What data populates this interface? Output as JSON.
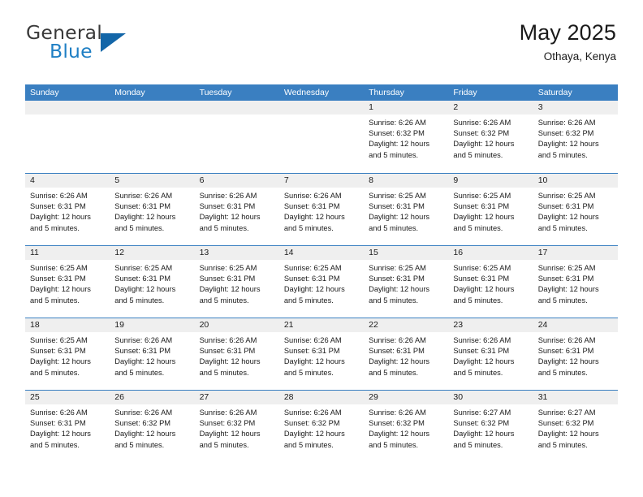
{
  "brand": {
    "name_top": "General",
    "name_bottom": "Blue",
    "triangle_icon": "brand-triangle-icon",
    "color_top": "#3a3a3a",
    "color_bottom": "#1f7fc4",
    "triangle_color": "#1366a8"
  },
  "header": {
    "title": "May 2025",
    "subtitle": "Othaya, Kenya"
  },
  "colors": {
    "header_band": "#3a7fc1",
    "day_head": "#efefef",
    "text": "#1a1a1a",
    "row_rule": "#3a7fc1"
  },
  "weekdays": [
    "Sunday",
    "Monday",
    "Tuesday",
    "Wednesday",
    "Thursday",
    "Friday",
    "Saturday"
  ],
  "labels": {
    "sunrise_prefix": "Sunrise:",
    "sunset_prefix": "Sunset:",
    "daylight_prefix": "Daylight:"
  },
  "weeks": [
    [
      {
        "day": "",
        "lines": []
      },
      {
        "day": "",
        "lines": []
      },
      {
        "day": "",
        "lines": []
      },
      {
        "day": "",
        "lines": []
      },
      {
        "day": "1",
        "lines": [
          "Sunrise: 6:26 AM",
          "Sunset: 6:32 PM",
          "Daylight: 12 hours",
          "and 5 minutes."
        ]
      },
      {
        "day": "2",
        "lines": [
          "Sunrise: 6:26 AM",
          "Sunset: 6:32 PM",
          "Daylight: 12 hours",
          "and 5 minutes."
        ]
      },
      {
        "day": "3",
        "lines": [
          "Sunrise: 6:26 AM",
          "Sunset: 6:32 PM",
          "Daylight: 12 hours",
          "and 5 minutes."
        ]
      }
    ],
    [
      {
        "day": "4",
        "lines": [
          "Sunrise: 6:26 AM",
          "Sunset: 6:31 PM",
          "Daylight: 12 hours",
          "and 5 minutes."
        ]
      },
      {
        "day": "5",
        "lines": [
          "Sunrise: 6:26 AM",
          "Sunset: 6:31 PM",
          "Daylight: 12 hours",
          "and 5 minutes."
        ]
      },
      {
        "day": "6",
        "lines": [
          "Sunrise: 6:26 AM",
          "Sunset: 6:31 PM",
          "Daylight: 12 hours",
          "and 5 minutes."
        ]
      },
      {
        "day": "7",
        "lines": [
          "Sunrise: 6:26 AM",
          "Sunset: 6:31 PM",
          "Daylight: 12 hours",
          "and 5 minutes."
        ]
      },
      {
        "day": "8",
        "lines": [
          "Sunrise: 6:25 AM",
          "Sunset: 6:31 PM",
          "Daylight: 12 hours",
          "and 5 minutes."
        ]
      },
      {
        "day": "9",
        "lines": [
          "Sunrise: 6:25 AM",
          "Sunset: 6:31 PM",
          "Daylight: 12 hours",
          "and 5 minutes."
        ]
      },
      {
        "day": "10",
        "lines": [
          "Sunrise: 6:25 AM",
          "Sunset: 6:31 PM",
          "Daylight: 12 hours",
          "and 5 minutes."
        ]
      }
    ],
    [
      {
        "day": "11",
        "lines": [
          "Sunrise: 6:25 AM",
          "Sunset: 6:31 PM",
          "Daylight: 12 hours",
          "and 5 minutes."
        ]
      },
      {
        "day": "12",
        "lines": [
          "Sunrise: 6:25 AM",
          "Sunset: 6:31 PM",
          "Daylight: 12 hours",
          "and 5 minutes."
        ]
      },
      {
        "day": "13",
        "lines": [
          "Sunrise: 6:25 AM",
          "Sunset: 6:31 PM",
          "Daylight: 12 hours",
          "and 5 minutes."
        ]
      },
      {
        "day": "14",
        "lines": [
          "Sunrise: 6:25 AM",
          "Sunset: 6:31 PM",
          "Daylight: 12 hours",
          "and 5 minutes."
        ]
      },
      {
        "day": "15",
        "lines": [
          "Sunrise: 6:25 AM",
          "Sunset: 6:31 PM",
          "Daylight: 12 hours",
          "and 5 minutes."
        ]
      },
      {
        "day": "16",
        "lines": [
          "Sunrise: 6:25 AM",
          "Sunset: 6:31 PM",
          "Daylight: 12 hours",
          "and 5 minutes."
        ]
      },
      {
        "day": "17",
        "lines": [
          "Sunrise: 6:25 AM",
          "Sunset: 6:31 PM",
          "Daylight: 12 hours",
          "and 5 minutes."
        ]
      }
    ],
    [
      {
        "day": "18",
        "lines": [
          "Sunrise: 6:25 AM",
          "Sunset: 6:31 PM",
          "Daylight: 12 hours",
          "and 5 minutes."
        ]
      },
      {
        "day": "19",
        "lines": [
          "Sunrise: 6:26 AM",
          "Sunset: 6:31 PM",
          "Daylight: 12 hours",
          "and 5 minutes."
        ]
      },
      {
        "day": "20",
        "lines": [
          "Sunrise: 6:26 AM",
          "Sunset: 6:31 PM",
          "Daylight: 12 hours",
          "and 5 minutes."
        ]
      },
      {
        "day": "21",
        "lines": [
          "Sunrise: 6:26 AM",
          "Sunset: 6:31 PM",
          "Daylight: 12 hours",
          "and 5 minutes."
        ]
      },
      {
        "day": "22",
        "lines": [
          "Sunrise: 6:26 AM",
          "Sunset: 6:31 PM",
          "Daylight: 12 hours",
          "and 5 minutes."
        ]
      },
      {
        "day": "23",
        "lines": [
          "Sunrise: 6:26 AM",
          "Sunset: 6:31 PM",
          "Daylight: 12 hours",
          "and 5 minutes."
        ]
      },
      {
        "day": "24",
        "lines": [
          "Sunrise: 6:26 AM",
          "Sunset: 6:31 PM",
          "Daylight: 12 hours",
          "and 5 minutes."
        ]
      }
    ],
    [
      {
        "day": "25",
        "lines": [
          "Sunrise: 6:26 AM",
          "Sunset: 6:31 PM",
          "Daylight: 12 hours",
          "and 5 minutes."
        ]
      },
      {
        "day": "26",
        "lines": [
          "Sunrise: 6:26 AM",
          "Sunset: 6:32 PM",
          "Daylight: 12 hours",
          "and 5 minutes."
        ]
      },
      {
        "day": "27",
        "lines": [
          "Sunrise: 6:26 AM",
          "Sunset: 6:32 PM",
          "Daylight: 12 hours",
          "and 5 minutes."
        ]
      },
      {
        "day": "28",
        "lines": [
          "Sunrise: 6:26 AM",
          "Sunset: 6:32 PM",
          "Daylight: 12 hours",
          "and 5 minutes."
        ]
      },
      {
        "day": "29",
        "lines": [
          "Sunrise: 6:26 AM",
          "Sunset: 6:32 PM",
          "Daylight: 12 hours",
          "and 5 minutes."
        ]
      },
      {
        "day": "30",
        "lines": [
          "Sunrise: 6:27 AM",
          "Sunset: 6:32 PM",
          "Daylight: 12 hours",
          "and 5 minutes."
        ]
      },
      {
        "day": "31",
        "lines": [
          "Sunrise: 6:27 AM",
          "Sunset: 6:32 PM",
          "Daylight: 12 hours",
          "and 5 minutes."
        ]
      }
    ]
  ]
}
